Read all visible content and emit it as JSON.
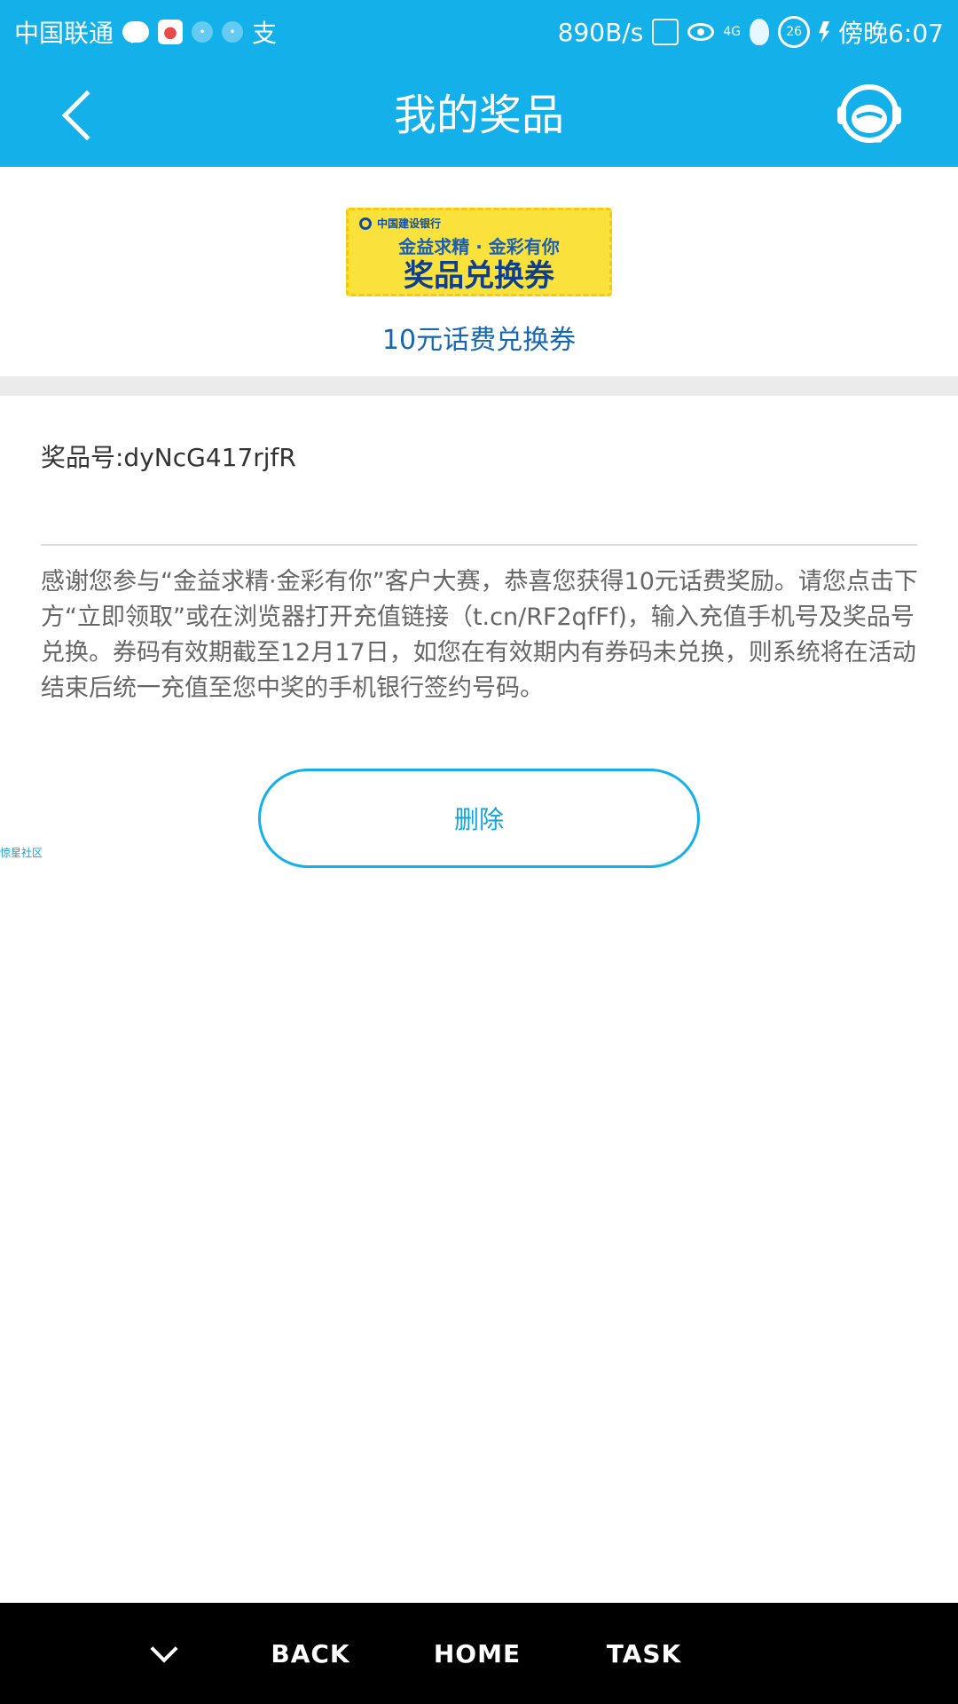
{
  "status_bar": {
    "carrier": "中国联通",
    "network_speed": "890B/s",
    "network_type": "4G",
    "battery_level": "26",
    "time": "傍晚6:07",
    "alipay_glyph": "支"
  },
  "header": {
    "title": "我的奖品"
  },
  "prize": {
    "voucher_bank": "中国建设银行",
    "voucher_slogan": "金益求精 · 金彩有你",
    "voucher_title": "奖品兑换券",
    "name": "10元话费兑换券",
    "code": "奖品号:dyNcG417rjfR",
    "description": "感谢您参与“金益求精·金彩有你”客户大赛，恭喜您获得10元话费奖励。请您点击下方“立即领取”或在浏览器打开充值链接（t.cn/RF2qfFf)，输入充值手机号及奖品号兑换。券码有效期截至12月17日，如您在有效期内有券码未兑换，则系统将在活动结束后统一充值至您中奖的手机银行签约号码。"
  },
  "actions": {
    "delete_label": "删除"
  },
  "side_tag": "惊星社区",
  "nav": {
    "back": "BACK",
    "home": "HOME",
    "task": "TASK"
  },
  "colors": {
    "primary": "#14b0ea",
    "prize_name": "#1666b4",
    "voucher_bg": "#fae13b"
  }
}
